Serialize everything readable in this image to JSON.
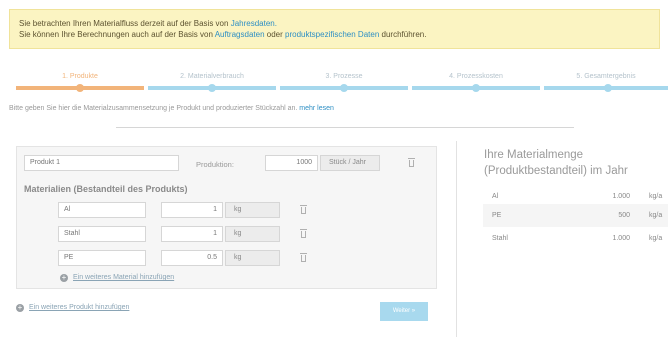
{
  "notice": {
    "line1_prefix": "Sie betrachten Ihren Materialfluss derzeit auf der Basis von",
    "line1_link": "Jahresdaten.",
    "line2_prefix": "Sie können Ihre Berechnungen auch auf der Basis von",
    "line2_link1": "Auftragsdaten",
    "line2_mid": "oder",
    "line2_link2": "produktspezifischen Daten",
    "line2_suffix": "durchführen."
  },
  "steps": [
    {
      "label": "1. Produkte",
      "active": true
    },
    {
      "label": "2. Materialverbrauch",
      "active": false
    },
    {
      "label": "3. Prozesse",
      "active": false
    },
    {
      "label": "4. Prozesskosten",
      "active": false
    },
    {
      "label": "5. Gesamtergebnis",
      "active": false
    }
  ],
  "colors": {
    "active_step": "#f2b47a",
    "inactive_step": "#a6d8ed",
    "accent_link": "#2e8fc4",
    "button": "#a8d9ee"
  },
  "intro": {
    "text": "Bitte geben Sie hier die Materialzusammensetzung je Produkt und produzierter Stückzahl an.",
    "more_link": "mehr lesen"
  },
  "product": {
    "name": "Produkt 1",
    "production_label": "Produktion:",
    "production_value": "1000",
    "production_unit": "Stück / Jahr",
    "materials_heading": "Materialien (Bestandteil des Produkts)",
    "materials": [
      {
        "name": "Al",
        "qty": "1",
        "unit": "kg"
      },
      {
        "name": "Stahl",
        "qty": "1",
        "unit": "kg"
      },
      {
        "name": "PE",
        "qty": "0.5",
        "unit": "kg"
      }
    ],
    "add_material": "Ein weiteres Material hinzufügen"
  },
  "add_product": "Ein weiteres Produkt hinzufügen",
  "next_button": "Weiter »",
  "summary": {
    "title_line1": "Ihre Materialmenge",
    "title_line2": "(Produktbestandteil) im Jahr",
    "rows": [
      {
        "material": "Al",
        "value": "1.000",
        "unit": "kg/a"
      },
      {
        "material": "PE",
        "value": "500",
        "unit": "kg/a"
      },
      {
        "material": "Stahl",
        "value": "1.000",
        "unit": "kg/a"
      }
    ]
  },
  "icons": {
    "delete": "trash-icon",
    "add": "plus-circle-icon"
  }
}
